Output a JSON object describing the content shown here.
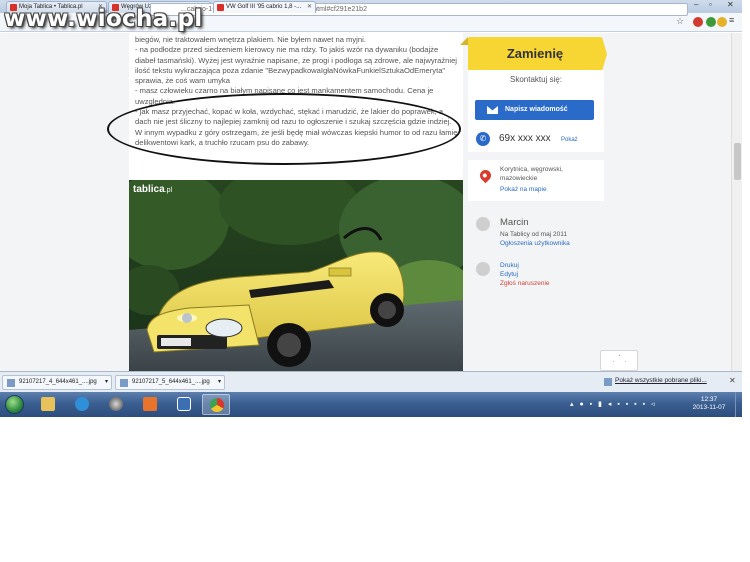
{
  "watermark": "www.wiocha.pl",
  "browser": {
    "tabs": [
      {
        "label": "Moja Tablica • Tablica.pl",
        "active": false
      },
      {
        "label": "Węgrów Używane samoc...",
        "active": false
      },
      {
        "label": "VW Golf III '95 cabrio 1,8 -...",
        "active": true
      }
    ],
    "url": "...cabrio-1-8-gaz-zamiana-CID5-ID2WBL8.html#cf291e21b2"
  },
  "listing": {
    "description": [
      "biegów, nie traktowałem wnętrza plakiem. Nie byłem nawet na myjni.",
      "- na podłodze przed siedzeniem kierowcy nie ma rdzy. To jakiś wzór na dywaniku (bodajże diabeł tasmański). Wyżej jest wyraźnie napisane, że progi i podłoga są zdrowe, ale najwyraźniej ilość tekstu wykraczająca poza zdanie \"BezwypadkowaIgłaNówkaFunkielSztukaOdEmeryta\" sprawia, że coś wam umyka",
      "- masz człowieku czarno na białym napisane co jest mankamentem samochodu. Cena je uwzględnia.",
      "- jak masz przyjechać, kopać w koła, wzdychać, stękać i marudzić, że lakier do poprawek, a dach nie jest śliczny to najlepiej zamknij od razu to ogłoszenie i szukaj szczęścia gdzie indziej. W innym wypadku z góry ostrzegam, że jeśli będę miał wówczas kiepski humor to od razu łamię delikwentowi kark, a truchło rzucam psu do zabawy."
    ],
    "photo_logo": "tablica",
    "photo_logo_suffix": ".pl"
  },
  "sidebar": {
    "exchange_label": "Zamienię",
    "contact_title": "Skontaktuj się:",
    "message_button": "Napisz wiadomość",
    "phone": "69x xxx xxx",
    "phone_show": "Pokaż",
    "location_lines": [
      "Korytnica, węgrowski,",
      "mazowieckie"
    ],
    "map_link": "Pokaż na mapie",
    "user_name": "Marcin",
    "user_since": "Na Tablicy od maj 2011",
    "user_ads_link": "Ogłoszenia użytkownika",
    "actions": [
      "Drukuj",
      "Edytuj",
      "Zgłoś naruszenie"
    ]
  },
  "downloads": {
    "items": [
      "92107217_4_644x461_....jpg",
      "92107217_5_644x461_....jpg"
    ],
    "show_all": "Pokaż wszystkie pobrane pliki..."
  },
  "taskbar": {
    "time": "12:37",
    "date": "2013-11-07"
  },
  "colors": {
    "accent_yellow": "#f7d533",
    "link_blue": "#2a6ac8",
    "taskbar_blue": "#3b5f91"
  }
}
